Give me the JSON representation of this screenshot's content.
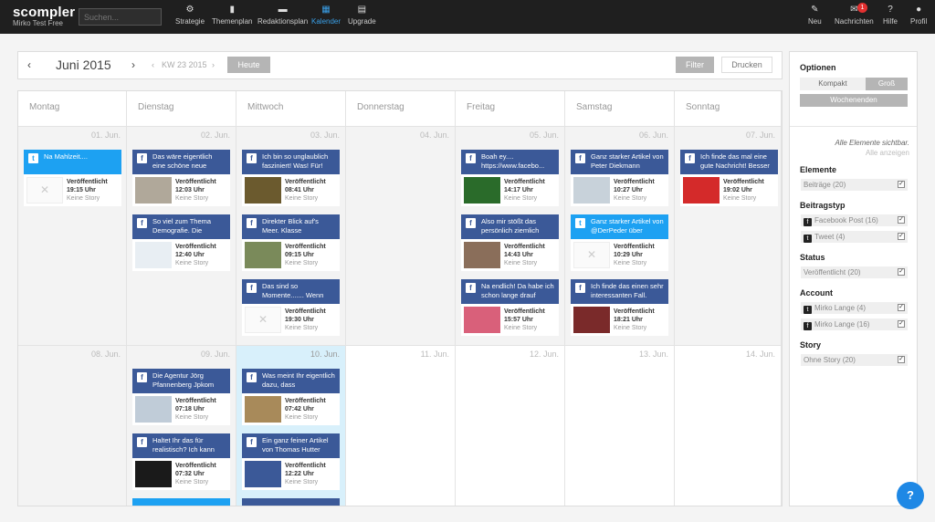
{
  "brand": {
    "logo": "scompler",
    "account": "Mirko Test Free"
  },
  "search": {
    "placeholder": "Suchen..."
  },
  "nav": [
    {
      "label": "Strategie",
      "icon": "gear-icon",
      "glyph": "⚙"
    },
    {
      "label": "Themenplan",
      "icon": "book-icon",
      "glyph": "▮"
    },
    {
      "label": "Redaktionsplan",
      "icon": "folder-icon",
      "glyph": "▬"
    },
    {
      "label": "Kalender",
      "icon": "calendar-icon",
      "glyph": "▦"
    },
    {
      "label": "Upgrade",
      "icon": "list-icon",
      "glyph": "▤"
    }
  ],
  "rightnav": [
    {
      "label": "Neu",
      "icon": "pencil-icon",
      "glyph": "✎"
    },
    {
      "label": "Nachrichten",
      "icon": "mail-icon",
      "glyph": "✉",
      "badge": "1"
    },
    {
      "label": "Hilfe",
      "icon": "question-icon",
      "glyph": "?"
    },
    {
      "label": "Profil",
      "icon": "user-icon",
      "glyph": "●"
    }
  ],
  "toolbar": {
    "month": "Juni 2015",
    "week": "KW 23 2015",
    "today": "Heute",
    "filter": "Filter",
    "print": "Drucken"
  },
  "days": [
    "Montag",
    "Dienstag",
    "Mittwoch",
    "Donnerstag",
    "Freitag",
    "Samstag",
    "Sonntag"
  ],
  "week1": [
    "01. Jun.",
    "02. Jun.",
    "03. Jun.",
    "04. Jun.",
    "05. Jun.",
    "06. Jun.",
    "07. Jun."
  ],
  "week2": [
    "08. Jun.",
    "09. Jun.",
    "10. Jun.",
    "11. Jun.",
    "12. Jun.",
    "13. Jun.",
    "14. Jun."
  ],
  "status": "Veröffentlicht",
  "story": "Keine Story",
  "posts": [
    {
      "d": 0,
      "w": 0,
      "s": 0,
      "type": "tw",
      "title": "Na Mahlzeit....",
      "time": "19:15 Uhr",
      "thumb": "ph"
    },
    {
      "d": 1,
      "w": 0,
      "s": 0,
      "type": "fb",
      "title": "Das wäre eigentlich eine schöne neue",
      "time": "12:03 Uhr",
      "thumb": "#b0a89a"
    },
    {
      "d": 1,
      "w": 0,
      "s": 1,
      "type": "fb",
      "title": "So viel zum Thema Demografie. Die",
      "time": "12:40 Uhr",
      "thumb": "#e8eef3"
    },
    {
      "d": 2,
      "w": 0,
      "s": 0,
      "type": "fb",
      "title": "Ich bin so unglaublich fasziniert! Was! Für!",
      "time": "08:41 Uhr",
      "thumb": "#6b5a2e"
    },
    {
      "d": 2,
      "w": 0,
      "s": 1,
      "type": "fb",
      "title": "Direkter Blick auf's Meer. Klasse",
      "time": "09:15 Uhr",
      "thumb": "#7a8a5a"
    },
    {
      "d": 2,
      "w": 0,
      "s": 2,
      "type": "fb",
      "title": "Das sind so Momente....... Wenn",
      "time": "19:30 Uhr",
      "thumb": "ph"
    },
    {
      "d": 4,
      "w": 0,
      "s": 0,
      "type": "fb",
      "title": "Boah ey.... https://www.facebo...",
      "time": "14:17 Uhr",
      "thumb": "#2a6b2a"
    },
    {
      "d": 4,
      "w": 0,
      "s": 1,
      "type": "fb",
      "title": "Also mir stößt das persönlich ziemlich",
      "time": "14:43 Uhr",
      "thumb": "#8a6e5a"
    },
    {
      "d": 4,
      "w": 0,
      "s": 2,
      "type": "fb",
      "title": "Na endlich! Da habe ich schon lange drauf",
      "time": "15:57 Uhr",
      "thumb": "#d9607a"
    },
    {
      "d": 5,
      "w": 0,
      "s": 0,
      "type": "fb",
      "title": "Ganz starker Artikel von Peter Diekmann",
      "time": "10:27 Uhr",
      "thumb": "#c8d2da"
    },
    {
      "d": 5,
      "w": 0,
      "s": 1,
      "type": "tw",
      "title": "Ganz starker Artikel von @DerPeder über",
      "time": "10:29 Uhr",
      "thumb": "ph"
    },
    {
      "d": 5,
      "w": 0,
      "s": 2,
      "type": "fb",
      "title": "Ich finde das einen sehr interessanten Fall.",
      "time": "18:21 Uhr",
      "thumb": "#7a2a2a"
    },
    {
      "d": 6,
      "w": 0,
      "s": 0,
      "type": "fb",
      "title": "Ich finde das mal eine gute Nachricht! Besser",
      "time": "19:02 Uhr",
      "thumb": "#d42a2a"
    },
    {
      "d": 1,
      "w": 1,
      "s": 0,
      "type": "fb",
      "title": "Die Agentur Jörg Pfannenberg Jpkom",
      "time": "07:18 Uhr",
      "thumb": "#c0ccd8"
    },
    {
      "d": 1,
      "w": 1,
      "s": 1,
      "type": "fb",
      "title": "Haltet Ihr das für realistisch? Ich kann",
      "time": "07:32 Uhr",
      "thumb": "#1a1a1a"
    },
    {
      "d": 2,
      "w": 1,
      "s": 0,
      "type": "fb",
      "title": "Was meint Ihr eigentlich dazu, dass",
      "time": "07:42 Uhr",
      "thumb": "#a88a5a"
    },
    {
      "d": 2,
      "w": 1,
      "s": 1,
      "type": "fb",
      "title": "Ein ganz feiner Artikel von Thomas Hutter",
      "time": "12:22 Uhr",
      "thumb": "#3b5998"
    }
  ],
  "extra": [
    {
      "d": 1,
      "type": "tw"
    },
    {
      "d": 2,
      "type": "fb"
    }
  ],
  "side": {
    "options_title": "Optionen",
    "kompakt": "Kompakt",
    "gross": "Groß",
    "wochenenden": "Wochenenden",
    "all_visible": "Alle Elemente sichtbar.",
    "all_show": "Alle anzeigen",
    "groups": [
      {
        "title": "Elemente",
        "items": [
          {
            "label": "Beiträge (20)"
          }
        ]
      },
      {
        "title": "Beitragstyp",
        "items": [
          {
            "label": "Facebook Post (16)",
            "icon": "f"
          },
          {
            "label": "Tweet (4)",
            "icon": "t"
          }
        ]
      },
      {
        "title": "Status",
        "items": [
          {
            "label": "Veröffentlicht (20)"
          }
        ]
      },
      {
        "title": "Account",
        "items": [
          {
            "label": "Mirko Lange (4)",
            "icon": "t"
          },
          {
            "label": "Mirko Lange (16)",
            "icon": "f"
          }
        ]
      },
      {
        "title": "Story",
        "items": [
          {
            "label": "Ohne Story (20)"
          }
        ]
      }
    ]
  },
  "colors": {
    "facebook": "#3b5998",
    "twitter": "#1da1f2",
    "accent": "#3aa0e8",
    "today": "#d8f0fb"
  }
}
